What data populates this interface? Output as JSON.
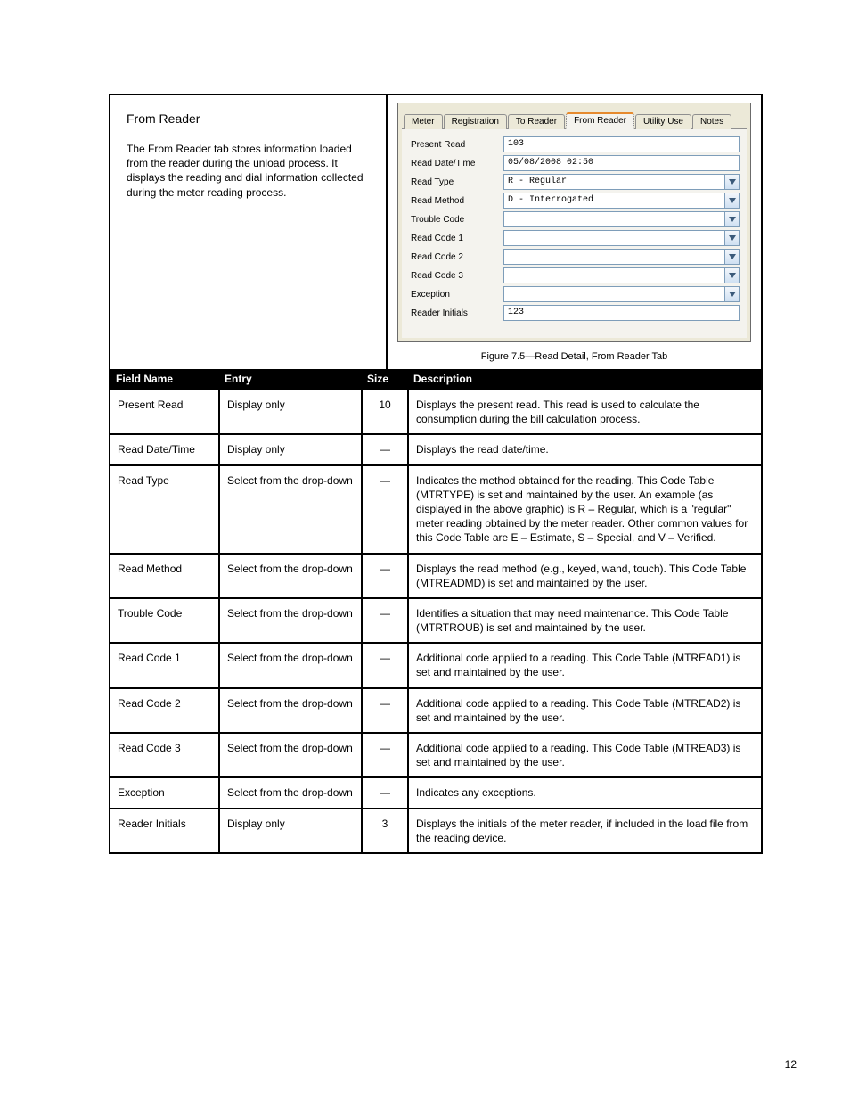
{
  "top_section": {
    "title": "From Reader",
    "description": "The From Reader tab stores information loaded from the reader during the unload process. It displays the reading and dial information collected during the meter reading process."
  },
  "panel": {
    "tabs": [
      "Meter",
      "Registration",
      "To Reader",
      "From Reader",
      "Utility Use",
      "Notes"
    ],
    "active_tab_index": 3,
    "rows": [
      {
        "label": "Present Read",
        "type": "text",
        "value": "103"
      },
      {
        "label": "Read Date/Time",
        "type": "text",
        "value": "05/08/2008 02:50"
      },
      {
        "label": "Read Type",
        "type": "select",
        "value": "R - Regular"
      },
      {
        "label": "Read Method",
        "type": "select",
        "value": "D - Interrogated"
      },
      {
        "label": "Trouble Code",
        "type": "select",
        "value": ""
      },
      {
        "label": "Read Code 1",
        "type": "select",
        "value": ""
      },
      {
        "label": "Read Code 2",
        "type": "select",
        "value": ""
      },
      {
        "label": "Read Code 3",
        "type": "select",
        "value": ""
      },
      {
        "label": "Exception",
        "type": "select",
        "value": ""
      },
      {
        "label": "Reader Initials",
        "type": "text",
        "value": "123"
      }
    ],
    "figure_caption": "Figure 7.5—Read Detail, From Reader Tab"
  },
  "table": {
    "headers": [
      "Field Name",
      "Entry",
      "Size",
      "Description"
    ],
    "rows": [
      {
        "field": "Present Read",
        "entry": "Display only",
        "size": "10",
        "desc": "Displays the present read. This read is used to calculate the consumption during the bill calculation process."
      },
      {
        "field": "Read Date/Time",
        "entry": "Display only",
        "size": "—",
        "desc": "Displays the read date/time."
      },
      {
        "field": "Read Type",
        "entry": "Select from the drop-down",
        "size": "—",
        "desc": "Indicates the method obtained for the reading. This Code Table (MTRTYPE) is set and maintained by the user. An example (as displayed in the above graphic) is R – Regular, which is a \"regular\" meter reading obtained by the meter reader. Other common values for this Code Table are E – Estimate, S – Special, and V – Verified."
      },
      {
        "field": "Read Method",
        "entry": "Select from the drop-down",
        "size": "—",
        "desc": "Displays the read method (e.g., keyed, wand, touch). This Code Table (MTREADMD) is set and maintained by the user."
      },
      {
        "field": "Trouble Code",
        "entry": "Select from the drop-down",
        "size": "—",
        "desc": "Identifies a situation that may need maintenance. This Code Table (MTRTROUB) is set and maintained by the user."
      },
      {
        "field": "Read Code 1",
        "entry": "Select from the drop-down",
        "size": "—",
        "desc": "Additional code applied to a reading. This Code Table (MTREAD1) is set and maintained by the user."
      },
      {
        "field": "Read Code 2",
        "entry": "Select from the drop-down",
        "size": "—",
        "desc": "Additional code applied to a reading. This Code Table (MTREAD2) is set and maintained by the user."
      },
      {
        "field": "Read Code 3",
        "entry": "Select from the drop-down",
        "size": "—",
        "desc": "Additional code applied to a reading. This Code Table (MTREAD3) is set and maintained by the user."
      },
      {
        "field": "Exception",
        "entry": "Select from the drop-down",
        "size": "—",
        "desc": "Indicates any exceptions."
      },
      {
        "field": "Reader Initials",
        "entry": "Display only",
        "size": "3",
        "desc": "Displays the initials of the meter reader, if included in the load file from the reading device."
      }
    ]
  },
  "page_number": "12"
}
